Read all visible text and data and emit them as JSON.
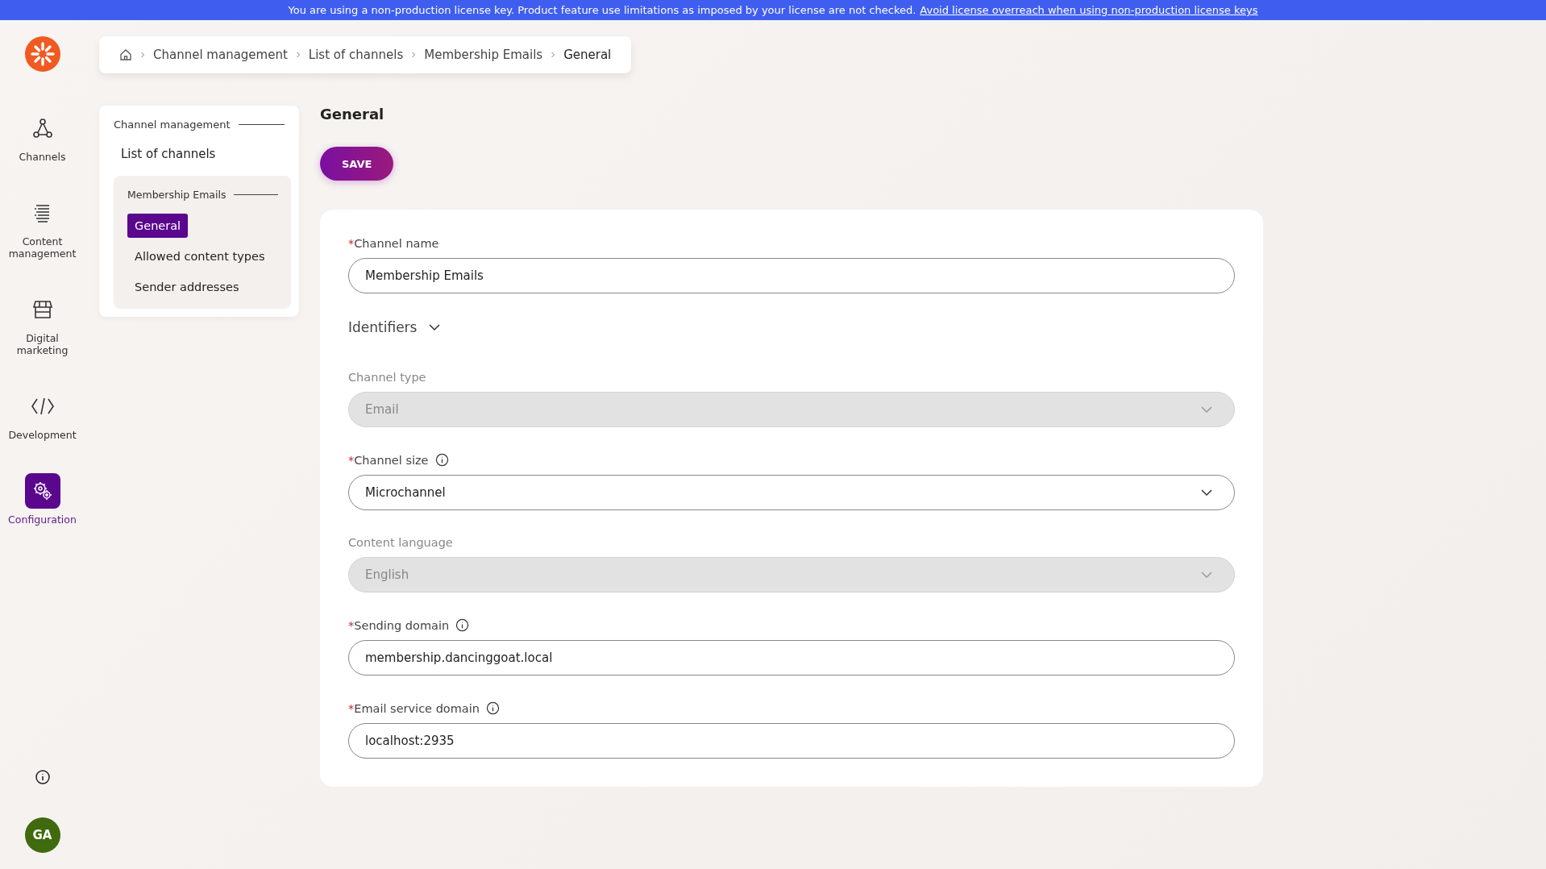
{
  "banner": {
    "text": "You are using a non-production license key. Product feature use limitations as imposed by your license are not checked.",
    "link": "Avoid license overreach when using non-production license keys"
  },
  "sidebar": {
    "items": [
      {
        "label": "Channels",
        "selected": false
      },
      {
        "label": "Content management",
        "selected": false
      },
      {
        "label": "Digital marketing",
        "selected": false
      },
      {
        "label": "Development",
        "selected": false
      },
      {
        "label": "Configuration",
        "selected": true
      }
    ],
    "avatar": "GA"
  },
  "breadcrumb": [
    "Channel management",
    "List of channels",
    "Membership Emails",
    "General"
  ],
  "nav": {
    "section": "Channel management",
    "list_link": "List of channels",
    "group": "Membership Emails",
    "items": [
      {
        "label": "General",
        "selected": true
      },
      {
        "label": "Allowed content types",
        "selected": false
      },
      {
        "label": "Sender addresses",
        "selected": false
      }
    ]
  },
  "page": {
    "title": "General",
    "save": "SAVE"
  },
  "form": {
    "fields": [
      {
        "kind": "text",
        "label": "Channel name",
        "required_mark": "*",
        "disabled": false,
        "value": "Membership Emails"
      },
      {
        "kind": "section",
        "label": "Identifiers",
        "expanded": false
      },
      {
        "kind": "select",
        "label": "Channel type",
        "disabled": true,
        "value": "Email"
      },
      {
        "kind": "select",
        "label": "Channel size",
        "required_mark": "*",
        "info": true,
        "disabled": false,
        "value": "Microchannel"
      },
      {
        "kind": "select",
        "label": "Content language",
        "disabled": true,
        "value": "English"
      },
      {
        "kind": "text",
        "label": "Sending domain",
        "required_mark": "*",
        "info": true,
        "disabled": false,
        "value": "membership.dancinggoat.local"
      },
      {
        "kind": "text",
        "label": "Email service domain",
        "required_mark": "*",
        "info": true,
        "disabled": false,
        "value": "localhost:2935"
      }
    ]
  }
}
